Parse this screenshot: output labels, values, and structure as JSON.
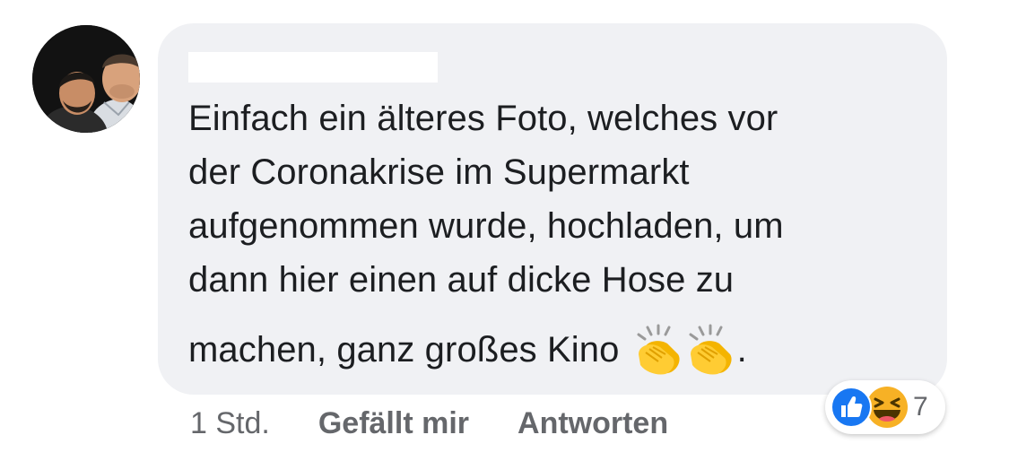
{
  "avatar": {
    "alt": "Profilbild"
  },
  "comment": {
    "lines": [
      "Einfach ein älteres Foto, welches vor",
      "der Coronakrise im Supermarkt",
      "aufgenommen wurde, hochladen, um",
      "dann hier einen auf dicke Hose zu",
      "machen, ganz großes Kino"
    ],
    "trailing_punctuation": ".",
    "emoji": [
      "clapping-hands",
      "clapping-hands"
    ]
  },
  "actions": {
    "time": "1 Std.",
    "like_label": "Gefällt mir",
    "reply_label": "Antworten"
  },
  "reactions": {
    "types": [
      "like",
      "haha"
    ],
    "count": "7"
  },
  "colors": {
    "bubble": "#f0f1f4",
    "text": "#1c1e21",
    "meta": "#65676b",
    "like_blue": "#1877f2",
    "haha_yellow": "#f7b125"
  }
}
